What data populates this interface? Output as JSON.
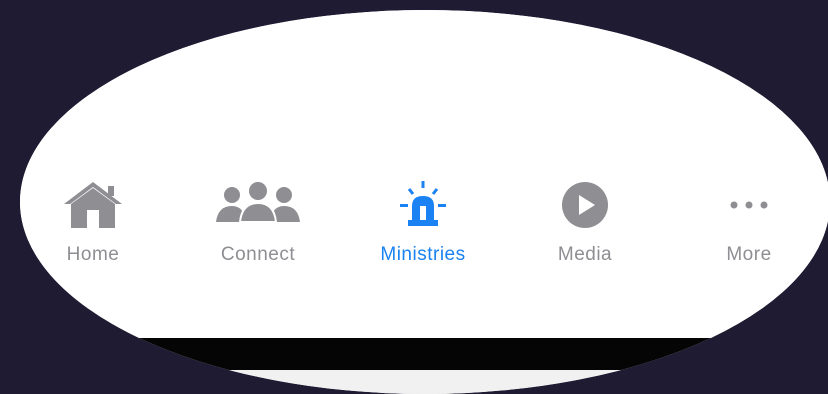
{
  "tabbar": {
    "tabs": [
      {
        "label": "Home",
        "icon": "house-icon",
        "active": false
      },
      {
        "label": "Connect",
        "icon": "people-group-icon",
        "active": false
      },
      {
        "label": "Ministries",
        "icon": "siren-icon",
        "active": true
      },
      {
        "label": "Media",
        "icon": "play-circle-icon",
        "active": false
      },
      {
        "label": "More",
        "icon": "more-dots-icon",
        "active": false
      }
    ]
  },
  "colors": {
    "active": "#1a82f2",
    "inactive": "#8e8e93",
    "background": "#1e1b33"
  }
}
